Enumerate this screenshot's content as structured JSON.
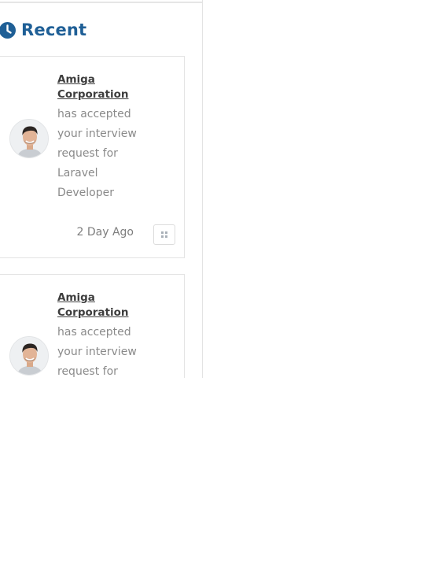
{
  "panel": {
    "title": "Recent",
    "icon": "clock-icon",
    "accent_color": "#1f5f96"
  },
  "notifications": [
    {
      "company": "Amiga Corporation",
      "message": "has accepted your interview request for Laravel Developer",
      "time": "2 Day Ago",
      "action_icon": "grid-icon"
    },
    {
      "company": "Amiga Corporation",
      "message": "has accepted your interview request for",
      "time": "",
      "action_icon": "grid-icon"
    }
  ]
}
